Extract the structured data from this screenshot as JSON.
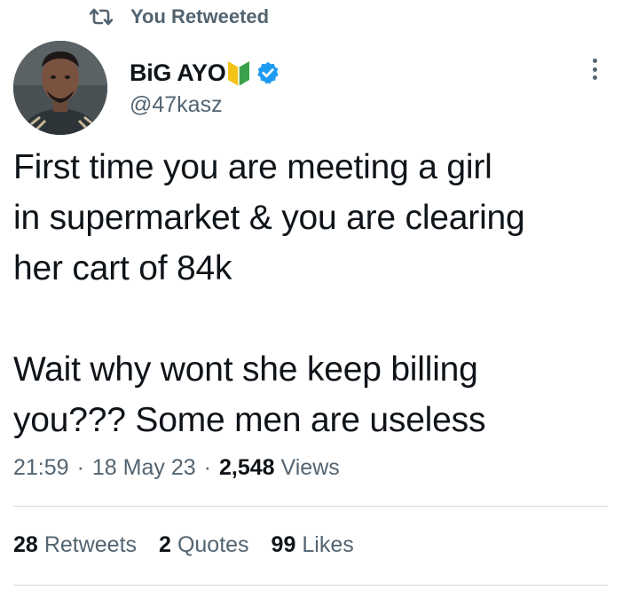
{
  "retweet_header": {
    "label": "You Retweeted",
    "icon": "retweet-icon"
  },
  "author": {
    "display_name": "BiG AYO",
    "handle": "@47kasz",
    "badges": [
      "beginner-mark-icon",
      "verified-icon"
    ],
    "verified_color": "#1d9bf0"
  },
  "tweet": {
    "text": "First time you are meeting a girl\nin supermarket & you are clearing\nher cart of 84k\n\nWait why wont she keep billing\nyou??? Some men are useless"
  },
  "meta": {
    "time": "21:59",
    "separator": "·",
    "date": "18 May 23",
    "views_count": "2,548",
    "views_label": "Views"
  },
  "stats": [
    {
      "count": "28",
      "label": "Retweets"
    },
    {
      "count": "2",
      "label": "Quotes"
    },
    {
      "count": "99",
      "label": "Likes"
    }
  ],
  "colors": {
    "text_primary": "#0f1419",
    "text_secondary": "#536471",
    "divider": "#cfd9de"
  }
}
